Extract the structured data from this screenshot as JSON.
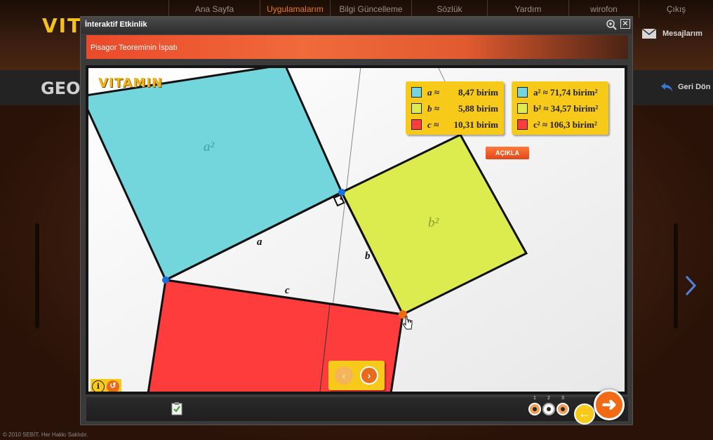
{
  "nav": {
    "items": [
      "Ana Sayfa",
      "Uygulamalarım",
      "Bilgi Güncelleme",
      "Sözlük",
      "Yardım",
      "wirofon",
      "Çıkış"
    ],
    "active_index": 1
  },
  "background": {
    "logo_text": "VITA",
    "section_title": "GEOM",
    "messages_label": "Mesajlarım",
    "back_label": "Geri Dön",
    "copyright": "© 2010 SEBİT. Her Hakkı Saklıdır."
  },
  "dialog": {
    "title": "İnteraktif Etkinlik",
    "subtitle": "Pisagor Teoreminin İspatı",
    "logo_text": "VITAMIN",
    "explain_button": "AÇIKLA",
    "legend_lengths": [
      {
        "symbol": "a ≈",
        "value": "8,47 birim",
        "color": "#72d6dc"
      },
      {
        "symbol": "b ≈",
        "value": "5,88 birim",
        "color": "#dcec4e"
      },
      {
        "symbol": "c ≈",
        "value": "10,31 birim",
        "color": "#ff3c3c"
      }
    ],
    "legend_areas": [
      {
        "text": "a² ≈ 71,74 birim²",
        "color": "#72d6dc"
      },
      {
        "text": "b² ≈ 34,57 birim²",
        "color": "#dcec4e"
      },
      {
        "text": "c² ≈ 106,3 birim²",
        "color": "#ff3c3c"
      }
    ],
    "labels": {
      "a_square": "a²",
      "b_square": "b²",
      "side_a": "a",
      "side_b": "b",
      "side_c": "c"
    },
    "step_numbers": [
      "1",
      "2",
      "3"
    ],
    "active_step": 2
  },
  "colors": {
    "square_a": "#72d6dc",
    "square_b": "#dcec4e",
    "square_c": "#ff3c3c",
    "point_blue": "#1a6fe0",
    "point_orange": "#f06a14",
    "accent": "#f26a14",
    "panel_yellow": "#f7c918"
  }
}
